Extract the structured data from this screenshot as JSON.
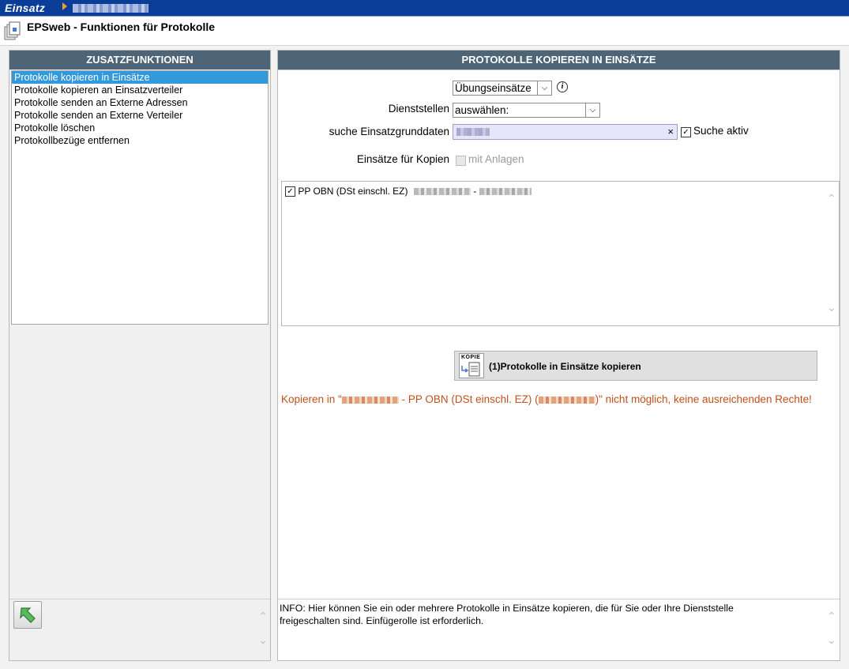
{
  "topbar": {
    "app_name": "Einsatz"
  },
  "titlebar": {
    "title": "EPSweb - Funktionen für Protokolle"
  },
  "left_panel": {
    "header": "ZUSATZFUNKTIONEN",
    "items": [
      {
        "label": "Protokolle kopieren in Einsätze",
        "selected": true
      },
      {
        "label": "Protokolle kopieren an Einsatzverteiler",
        "selected": false
      },
      {
        "label": "Protokolle senden an Externe Adressen",
        "selected": false
      },
      {
        "label": "Protokolle senden an Externe Verteiler",
        "selected": false
      },
      {
        "label": "Protokolle löschen",
        "selected": false
      },
      {
        "label": "Protokollbezüge entfernen",
        "selected": false
      }
    ]
  },
  "right_panel": {
    "header": "PROTOKOLLE KOPIEREN IN EINSÄTZE",
    "type_select": {
      "value": "Übungseinsätze"
    },
    "dienststellen": {
      "label": "Dienststellen",
      "value": "auswählen:"
    },
    "search": {
      "label": "suche Einsatzgrunddaten",
      "clear": "×",
      "active_label": "Suche aktiv",
      "active_checked": true
    },
    "kopien": {
      "label": "Einsätze für Kopien",
      "anlagen_label": "mit Anlagen",
      "anlagen_checked": false,
      "anlagen_disabled": true
    },
    "results": [
      {
        "label": "PP OBN (DSt einschl. EZ)",
        "sep": "-",
        "checked": true
      }
    ],
    "copy_button": {
      "label": "(1)Protokolle in Einsätze kopieren",
      "icon_text": "KOPIE"
    },
    "warning": {
      "prefix": "Kopieren in \"",
      "middle": " - PP OBN (DSt einschl. EZ) (",
      "suffix": ")\" nicht möglich, keine ausreichenden Rechte!"
    },
    "info": "INFO: Hier können Sie ein oder mehrere Protokolle in Einsätze kopieren, die für Sie oder Ihre Dienststelle freigeschalten sind. Einfügerolle ist erforderlich."
  },
  "colors": {
    "header_bg": "#4e6578",
    "topbar_bg": "#0a3d98",
    "selection": "#3399dd",
    "warning": "#c0511a",
    "search_bg": "#e6e6fa"
  },
  "icons": [
    "document-stack-icon",
    "info-icon",
    "copy-document-icon",
    "back-arrow-icon",
    "chevron-up-icon",
    "chevron-down-icon"
  ]
}
